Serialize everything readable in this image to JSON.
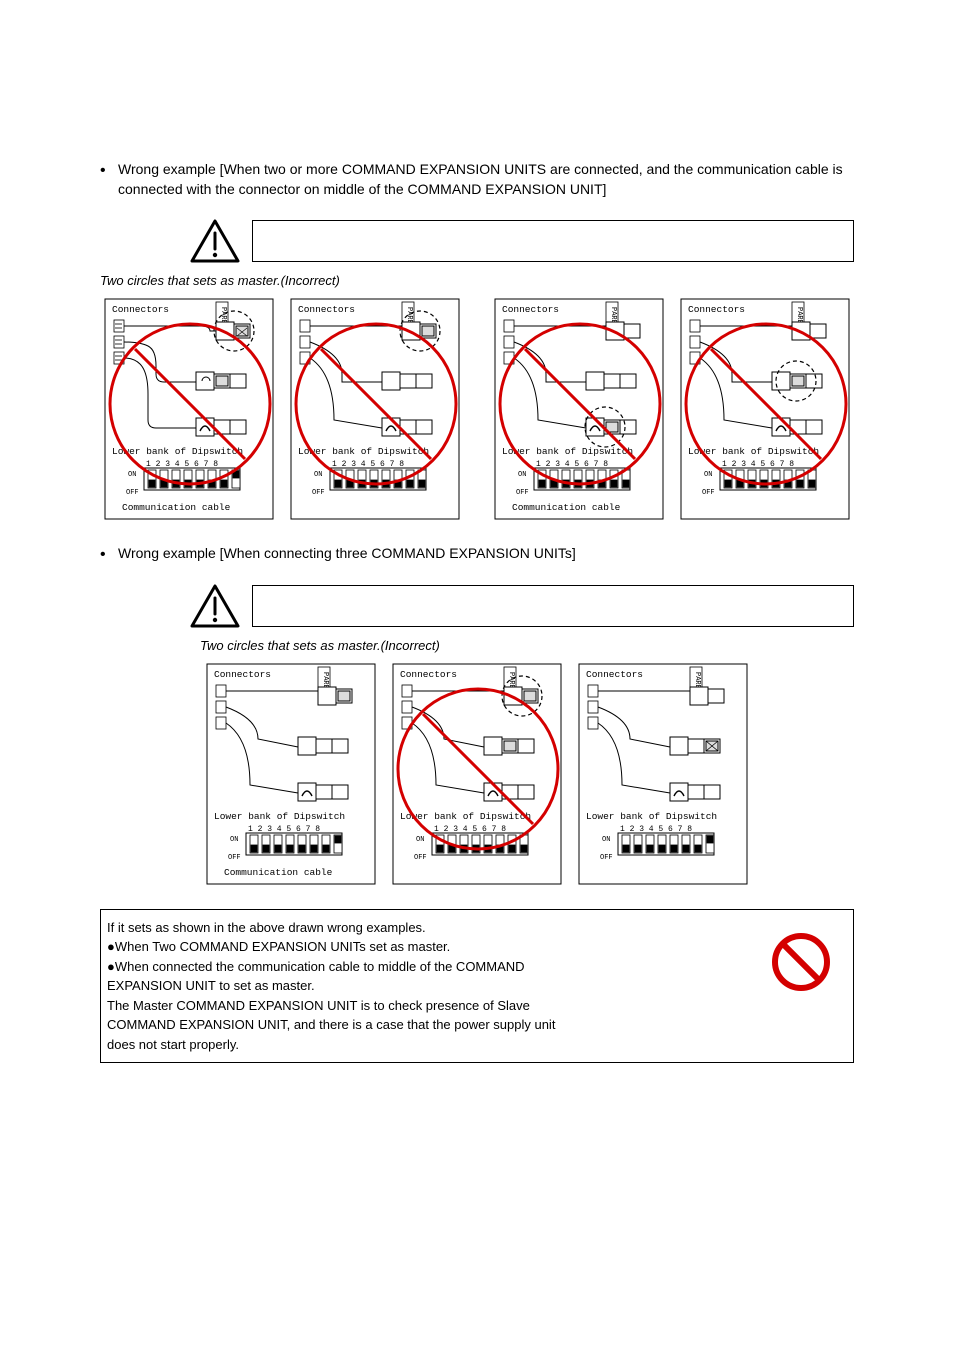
{
  "text": {
    "bullet_two": "Wrong example [When two or more COMMAND EXPANSION UNITS are connected, and the communication cable is connected with the connector on middle of the COMMAND EXPANSION UNIT]",
    "bullet_three": "Wrong example [When connecting three COMMAND EXPANSION UNITs]",
    "incorrect_2_note": "Two circles that sets as master.(Incorrect)",
    "incorrect_3_note": "Two circles that sets as master.(Incorrect)",
    "connectors_label": "Connectors",
    "parent_label": "PARENT",
    "dipswitch_label": "Lower bank of Dipswitch",
    "dip_numbers": "1 2 3 4 5 6 7 8",
    "on_label": "ON",
    "off_label": "OFF",
    "comm_cable": "Communication cable",
    "prohibit_lines": [
      "If it sets as shown in the above drawn wrong examples.",
      "●When Two COMMAND EXPANSION UNITs set as master.",
      "●When connected the communication cable to middle of the COMMAND",
      "EXPANSION UNIT to set as master.",
      "The Master COMMAND EXPANSION UNIT is to check presence of Slave",
      "COMMAND EXPANSION UNIT, and there is a case that the power supply unit",
      "does not start properly."
    ]
  },
  "chart_data": {
    "type": "diagram",
    "description": "Wiring examples for COMMAND EXPANSION UNIT connections showing incorrect master/slave dipswitch configurations with prohibition overlays.",
    "example_two_boards": [
      {
        "group": "left-pair",
        "boards": [
          {
            "master_highlight": "top",
            "dip8": "on",
            "prohibit": true
          },
          {
            "master_highlight": "top",
            "dip8": "off",
            "prohibit": true
          }
        ]
      },
      {
        "group": "right-pair",
        "boards": [
          {
            "master_highlight": "bottom",
            "dip8": "off",
            "prohibit": true
          },
          {
            "master_highlight": "middle",
            "dip8": "off",
            "prohibit": true
          }
        ]
      }
    ],
    "example_three_boards": [
      {
        "master_highlight": "top",
        "dip8": "on",
        "prohibit": false
      },
      {
        "master_highlight": "top",
        "dip8": "off",
        "prohibit": true
      },
      {
        "master_highlight": "top",
        "dip8": "on",
        "prohibit": false,
        "x_connector": true
      }
    ],
    "dipswitch_positions_meaning": "Switch 8 up = ON (master), down = OFF (slave)"
  }
}
